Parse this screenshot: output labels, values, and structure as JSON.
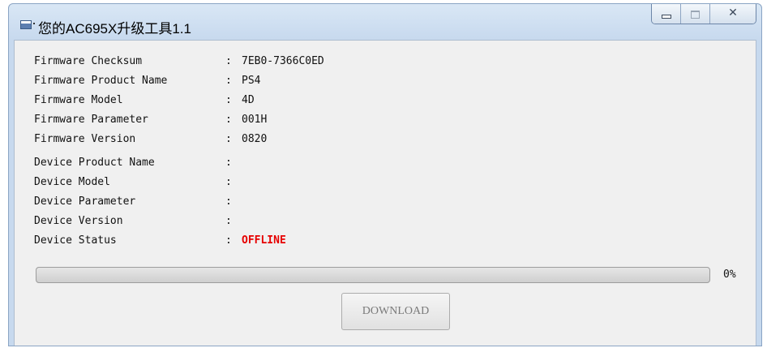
{
  "window": {
    "title": "您的AC695X升级工具1.1",
    "app_icon": "window-icon",
    "caption_icons": [
      "minimize-icon",
      "maximize-icon",
      "close-icon"
    ],
    "close_glyph": "✕"
  },
  "firmware": [
    {
      "label": "Firmware Checksum",
      "colon": ":",
      "value": "7EB0-7366C0ED"
    },
    {
      "label": "Firmware Product Name",
      "colon": ":",
      "value": "PS4"
    },
    {
      "label": "Firmware Model",
      "colon": ":",
      "value": "4D"
    },
    {
      "label": "Firmware Parameter",
      "colon": ":",
      "value": "001H"
    },
    {
      "label": "Firmware Version",
      "colon": ":",
      "value": "0820"
    }
  ],
  "device": [
    {
      "label": "Device Product Name",
      "colon": ":",
      "value": ""
    },
    {
      "label": "Device Model",
      "colon": ":",
      "value": ""
    },
    {
      "label": "Device Parameter",
      "colon": ":",
      "value": ""
    },
    {
      "label": "Device Version",
      "colon": ":",
      "value": ""
    },
    {
      "label": "Device Status",
      "colon": ":",
      "value": "OFFLINE"
    }
  ],
  "progress": {
    "value": 0,
    "text": "0%"
  },
  "download_button": {
    "label": "DOWNLOAD",
    "enabled": false
  },
  "colors": {
    "status_offline": "#e60000",
    "progress_fill": "#06b025"
  }
}
